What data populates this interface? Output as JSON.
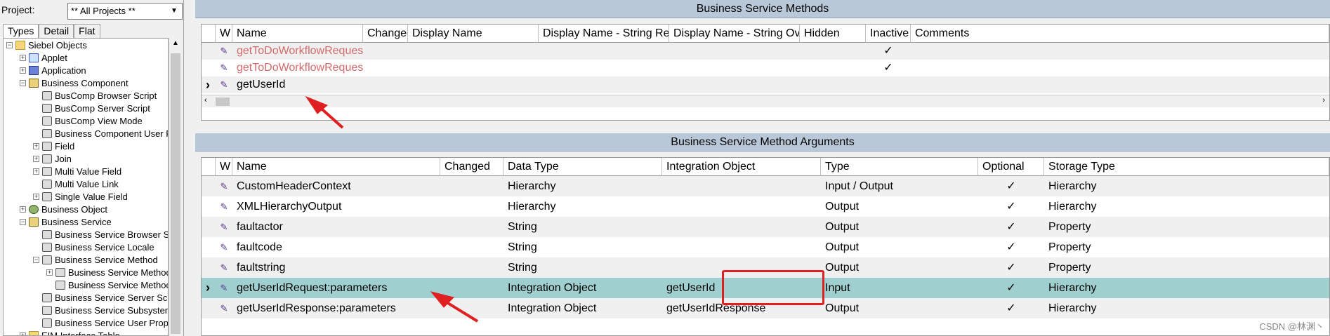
{
  "project": {
    "label": "Project:",
    "value": "** All Projects **"
  },
  "tabs": [
    "Types",
    "Detail",
    "Flat"
  ],
  "tree": [
    {
      "label": "Siebel Objects",
      "level": 0,
      "exp": "−",
      "icon": "folder"
    },
    {
      "label": "Applet",
      "level": 1,
      "exp": "+",
      "icon": "applet"
    },
    {
      "label": "Application",
      "level": 1,
      "exp": "+",
      "icon": "app"
    },
    {
      "label": "Business Component",
      "level": 1,
      "exp": "−",
      "icon": "bc"
    },
    {
      "label": "BusComp Browser Script",
      "level": 2,
      "exp": "",
      "icon": "script"
    },
    {
      "label": "BusComp Server Script",
      "level": 2,
      "exp": "",
      "icon": "script"
    },
    {
      "label": "BusComp View Mode",
      "level": 2,
      "exp": "",
      "icon": "script"
    },
    {
      "label": "Business Component User Prop",
      "level": 2,
      "exp": "",
      "icon": "script"
    },
    {
      "label": "Field",
      "level": 2,
      "exp": "+",
      "icon": "script"
    },
    {
      "label": "Join",
      "level": 2,
      "exp": "+",
      "icon": "script"
    },
    {
      "label": "Multi Value Field",
      "level": 2,
      "exp": "+",
      "icon": "script"
    },
    {
      "label": "Multi Value Link",
      "level": 2,
      "exp": "",
      "icon": "script"
    },
    {
      "label": "Single Value Field",
      "level": 2,
      "exp": "+",
      "icon": "script"
    },
    {
      "label": "Business Object",
      "level": 1,
      "exp": "+",
      "icon": "bo"
    },
    {
      "label": "Business Service",
      "level": 1,
      "exp": "−",
      "icon": "bc"
    },
    {
      "label": "Business Service Browser Script",
      "level": 2,
      "exp": "",
      "icon": "script"
    },
    {
      "label": "Business Service Locale",
      "level": 2,
      "exp": "",
      "icon": "script"
    },
    {
      "label": "Business Service Method",
      "level": 2,
      "exp": "−",
      "icon": "script"
    },
    {
      "label": "Business Service Method Arg",
      "level": 3,
      "exp": "+",
      "icon": "script"
    },
    {
      "label": "Business Service Method Locale",
      "level": 3,
      "exp": "",
      "icon": "script"
    },
    {
      "label": "Business Service Server Script",
      "level": 2,
      "exp": "",
      "icon": "script"
    },
    {
      "label": "Business Service Subsystem",
      "level": 2,
      "exp": "",
      "icon": "script"
    },
    {
      "label": "Business Service User Prop",
      "level": 2,
      "exp": "",
      "icon": "script"
    },
    {
      "label": "EIM Interface Table",
      "level": 1,
      "exp": "+",
      "icon": "folder"
    }
  ],
  "methods": {
    "title": "Business Service Methods",
    "headers": [
      "W",
      "Name",
      "Changed",
      "Display Name",
      "Display Name - String Reference",
      "Display Name - String Override",
      "Hidden",
      "Inactive",
      "Comments"
    ],
    "rows": [
      {
        "name": "getToDoWorkflowRequestCount",
        "inactive": "✓",
        "red": true
      },
      {
        "name": "getToDoWorkflowRequestList",
        "inactive": "✓",
        "red": true
      },
      {
        "name": "getUserId",
        "inactive": "",
        "red": false
      }
    ]
  },
  "args": {
    "title": "Business Service Method Arguments",
    "headers": [
      "W",
      "Name",
      "Changed",
      "Data Type",
      "Integration Object",
      "Type",
      "Optional",
      "Storage Type"
    ],
    "rows": [
      {
        "name": "CustomHeaderContext",
        "data_type": "Hierarchy",
        "io": "",
        "type": "Input / Output",
        "optional": "✓",
        "storage": "Hierarchy"
      },
      {
        "name": "XMLHierarchyOutput",
        "data_type": "Hierarchy",
        "io": "",
        "type": "Output",
        "optional": "✓",
        "storage": "Hierarchy"
      },
      {
        "name": "faultactor",
        "data_type": "String",
        "io": "",
        "type": "Output",
        "optional": "✓",
        "storage": "Property"
      },
      {
        "name": "faultcode",
        "data_type": "String",
        "io": "",
        "type": "Output",
        "optional": "✓",
        "storage": "Property"
      },
      {
        "name": "faultstring",
        "data_type": "String",
        "io": "",
        "type": "Output",
        "optional": "✓",
        "storage": "Property"
      },
      {
        "name": "getUserIdRequest:parameters",
        "data_type": "Integration Object",
        "io": "getUserId",
        "type": "Input",
        "optional": "✓",
        "storage": "Hierarchy"
      },
      {
        "name": "getUserIdResponse:parameters",
        "data_type": "Integration Object",
        "io": "getUserIdResponse",
        "type": "Output",
        "optional": "✓",
        "storage": "Hierarchy"
      }
    ]
  },
  "watermark": "CSDN @林渊丶",
  "colors": {
    "selected_row": "#9fcfcf",
    "annotation": "#e02020",
    "inactive_name": "#d46a6a"
  }
}
